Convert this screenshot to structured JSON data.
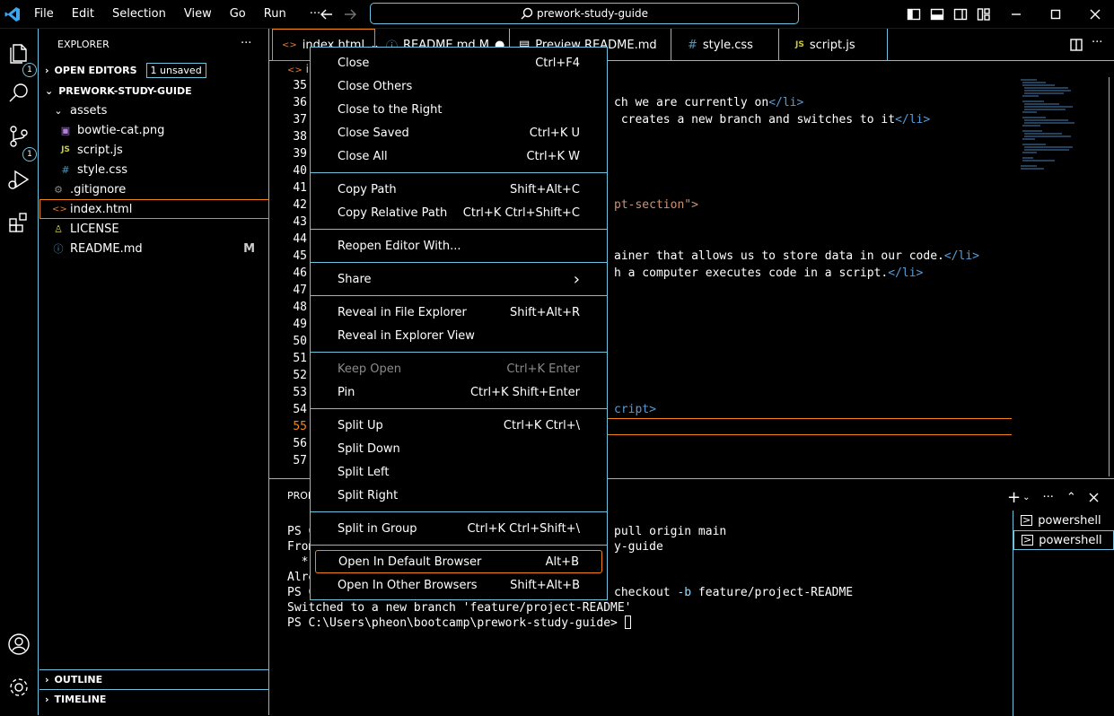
{
  "menubar": [
    "File",
    "Edit",
    "Selection",
    "View",
    "Go",
    "Run",
    "···"
  ],
  "search": {
    "text": "prework-study-guide"
  },
  "explorer": {
    "title": "EXPLORER",
    "more": "···",
    "open_editors": "OPEN EDITORS",
    "unsaved": "1 unsaved",
    "project": "PREWORK-STUDY-GUIDE",
    "tree": [
      {
        "label": "assets",
        "icon": "chevron-down-icon"
      },
      {
        "label": "bowtie-cat.png",
        "icon": "image-icon"
      },
      {
        "label": "script.js",
        "icon": "JS"
      },
      {
        "label": "style.css",
        "icon": "#"
      },
      {
        "label": ".gitignore",
        "icon": "gear-dot-icon"
      },
      {
        "label": "index.html",
        "icon": "<>"
      },
      {
        "label": "LICENSE",
        "icon": "license-icon"
      },
      {
        "label": "README.md",
        "icon": "info-icon",
        "badge": "M"
      }
    ],
    "outline": "OUTLINE",
    "timeline": "TIMELINE"
  },
  "tabs": [
    "index.html",
    "README.md M",
    "Preview README.md",
    "style.css",
    "script.js"
  ],
  "breadcrumb": "in",
  "code": {
    "line_numbers": [
      "35",
      "36",
      "37",
      "38",
      "39",
      "40",
      "41",
      "42",
      "43",
      "44",
      "45",
      "46",
      "47",
      "48",
      "49",
      "50",
      "51",
      "52",
      "53",
      "54",
      "55",
      "56",
      "57"
    ],
    "fragments": {
      "l36a": "ch we are currently on",
      "l36b": "</li>",
      "l37a": " creates a new branch and switches to it",
      "l37b": "</li>",
      "l42": "pt-section\">",
      "l45a": "ainer that allows us to store data in our code.",
      "l45b": "</li>",
      "l46a": "h a computer executes code in a script.",
      "l46b": "</li>",
      "l54": "cript>"
    }
  },
  "panel": {
    "tab": "PROB",
    "terminal": [
      "PS C",
      "From",
      "  * b",
      "Alre",
      "PS C",
      "Switched to a new branch 'feature/project-README'",
      "PS C:\\Users\\pheon\\bootcamp\\prework-study-guide> "
    ],
    "terminal_tail": {
      "l1": "pull origin main",
      "l2": "y-guide",
      "l5a": "checkout ",
      "l5b": "-b",
      "l5c": " feature/project-README"
    },
    "terminals": [
      "powershell",
      "powershell"
    ]
  },
  "context_menu": [
    {
      "label": "Close",
      "kb": "Ctrl+F4"
    },
    {
      "label": "Close Others",
      "kb": ""
    },
    {
      "label": "Close to the Right",
      "kb": ""
    },
    {
      "label": "Close Saved",
      "kb": "Ctrl+K U"
    },
    {
      "label": "Close All",
      "kb": "Ctrl+K W"
    },
    {
      "label": "Copy Path",
      "kb": "Shift+Alt+C"
    },
    {
      "label": "Copy Relative Path",
      "kb": "Ctrl+K Ctrl+Shift+C"
    },
    {
      "label": "Reopen Editor With...",
      "kb": ""
    },
    {
      "label": "Share",
      "kb": "›"
    },
    {
      "label": "Reveal in File Explorer",
      "kb": "Shift+Alt+R"
    },
    {
      "label": "Reveal in Explorer View",
      "kb": ""
    },
    {
      "label": "Keep Open",
      "kb": "Ctrl+K Enter"
    },
    {
      "label": "Pin",
      "kb": "Ctrl+K Shift+Enter"
    },
    {
      "label": "Split Up",
      "kb": "Ctrl+K Ctrl+\\"
    },
    {
      "label": "Split Down",
      "kb": ""
    },
    {
      "label": "Split Left",
      "kb": ""
    },
    {
      "label": "Split Right",
      "kb": ""
    },
    {
      "label": "Split in Group",
      "kb": "Ctrl+K Ctrl+Shift+\\"
    },
    {
      "label": "Open In Default Browser",
      "kb": "Alt+B"
    },
    {
      "label": "Open In Other Browsers",
      "kb": "Shift+Alt+B"
    }
  ],
  "colors": {
    "accent": "#6fc3df",
    "focus": "#f38518",
    "tag": "#569cd6",
    "string": "#ce9178"
  }
}
